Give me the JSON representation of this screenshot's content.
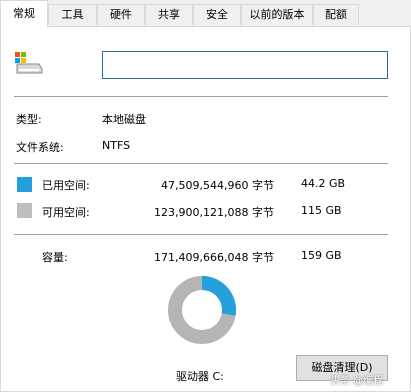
{
  "tabs": [
    {
      "label": "常规"
    },
    {
      "label": "工具"
    },
    {
      "label": "硬件"
    },
    {
      "label": "共享"
    },
    {
      "label": "安全"
    },
    {
      "label": "以前的版本"
    },
    {
      "label": "配额"
    }
  ],
  "drive_icon": "drive-icon",
  "name_field": {
    "value": ""
  },
  "info": {
    "type_label": "类型:",
    "type_value": "本地磁盘",
    "fs_label": "文件系统:",
    "fs_value": "NTFS"
  },
  "used": {
    "label": "已用空间:",
    "bytes": "47,509,544,960 字节",
    "size": "44.2 GB",
    "color": "#26a0da"
  },
  "free": {
    "label": "可用空间:",
    "bytes": "123,900,121,088 字节",
    "size": "115 GB",
    "color": "#bebebe"
  },
  "capacity": {
    "label": "容量:",
    "bytes": "171,409,666,048 字节",
    "size": "159 GB"
  },
  "usage_fraction": 0.277,
  "drive_label": "驱动器 C:",
  "cleanup_button": "磁盘清理(D)",
  "watermark": "头条 @编程"
}
